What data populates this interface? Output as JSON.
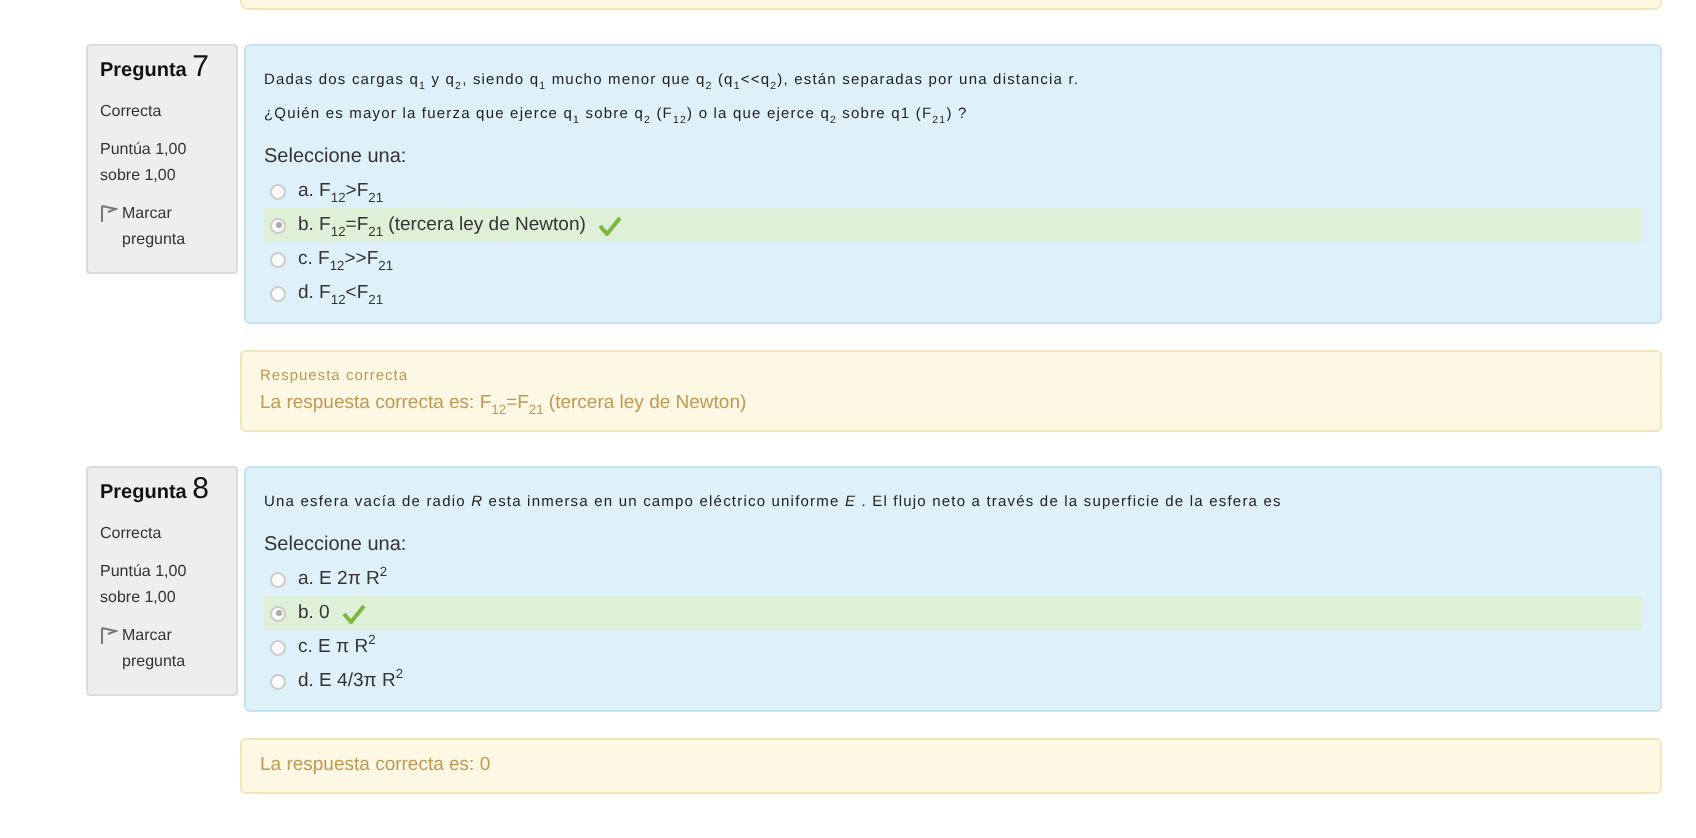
{
  "questions": [
    {
      "label": "Pregunta",
      "number": "7",
      "state": "Correcta",
      "grade": "Puntúa 1,00 sobre 1,00",
      "flag": "Marcar pregunta",
      "prompt": [
        "Dadas dos cargas q$_{1}$ y q$_{2}$, siendo q$_{1}$ mucho menor que q$_{2}$ (q$_{1}$<<q$_{2}$), están separadas por una distancia r.",
        "¿Quién es mayor la fuerza que ejerce q$_{1}$ sobre q$_{2}$ (F$_{12}$) o la que ejerce q$_{2}$ sobre q1 (F$_{21}$) ?"
      ],
      "select_label": "Seleccione una:",
      "options": [
        {
          "text": "a. F$_{12}$>F$_{21}$",
          "selected": false,
          "correct": false
        },
        {
          "text": "b. F$_{12}$=F$_{21}$ (tercera ley de Newton)",
          "selected": true,
          "correct": true
        },
        {
          "text": "c. F$_{12}$>>F$_{21}$",
          "selected": false,
          "correct": false
        },
        {
          "text": "d. F$_{12}$<F$_{21}$",
          "selected": false,
          "correct": false
        }
      ],
      "feedback": {
        "title": "Respuesta correcta",
        "answer": "La respuesta correcta es: F$_{12}$=F$_{21}$ (tercera ley de Newton)"
      }
    },
    {
      "label": "Pregunta",
      "number": "8",
      "state": "Correcta",
      "grade": "Puntúa 1,00 sobre 1,00",
      "flag": "Marcar pregunta",
      "prompt": [
        "Una esfera vacía de radio *R* esta inmersa en un campo eléctrico uniforme *E* . El flujo neto a través de la superficie de la esfera es"
      ],
      "select_label": "Seleccione una:",
      "options": [
        {
          "text": "a. E 2π R$^{2}$",
          "selected": false,
          "correct": false
        },
        {
          "text": "b. 0",
          "selected": true,
          "correct": true
        },
        {
          "text": "c. E π R$^{2}$",
          "selected": false,
          "correct": false
        },
        {
          "text": "d. E 4/3π R$^{2}$",
          "selected": false,
          "correct": false
        }
      ],
      "feedback": {
        "answer": "La respuesta correcta es: 0"
      }
    }
  ]
}
